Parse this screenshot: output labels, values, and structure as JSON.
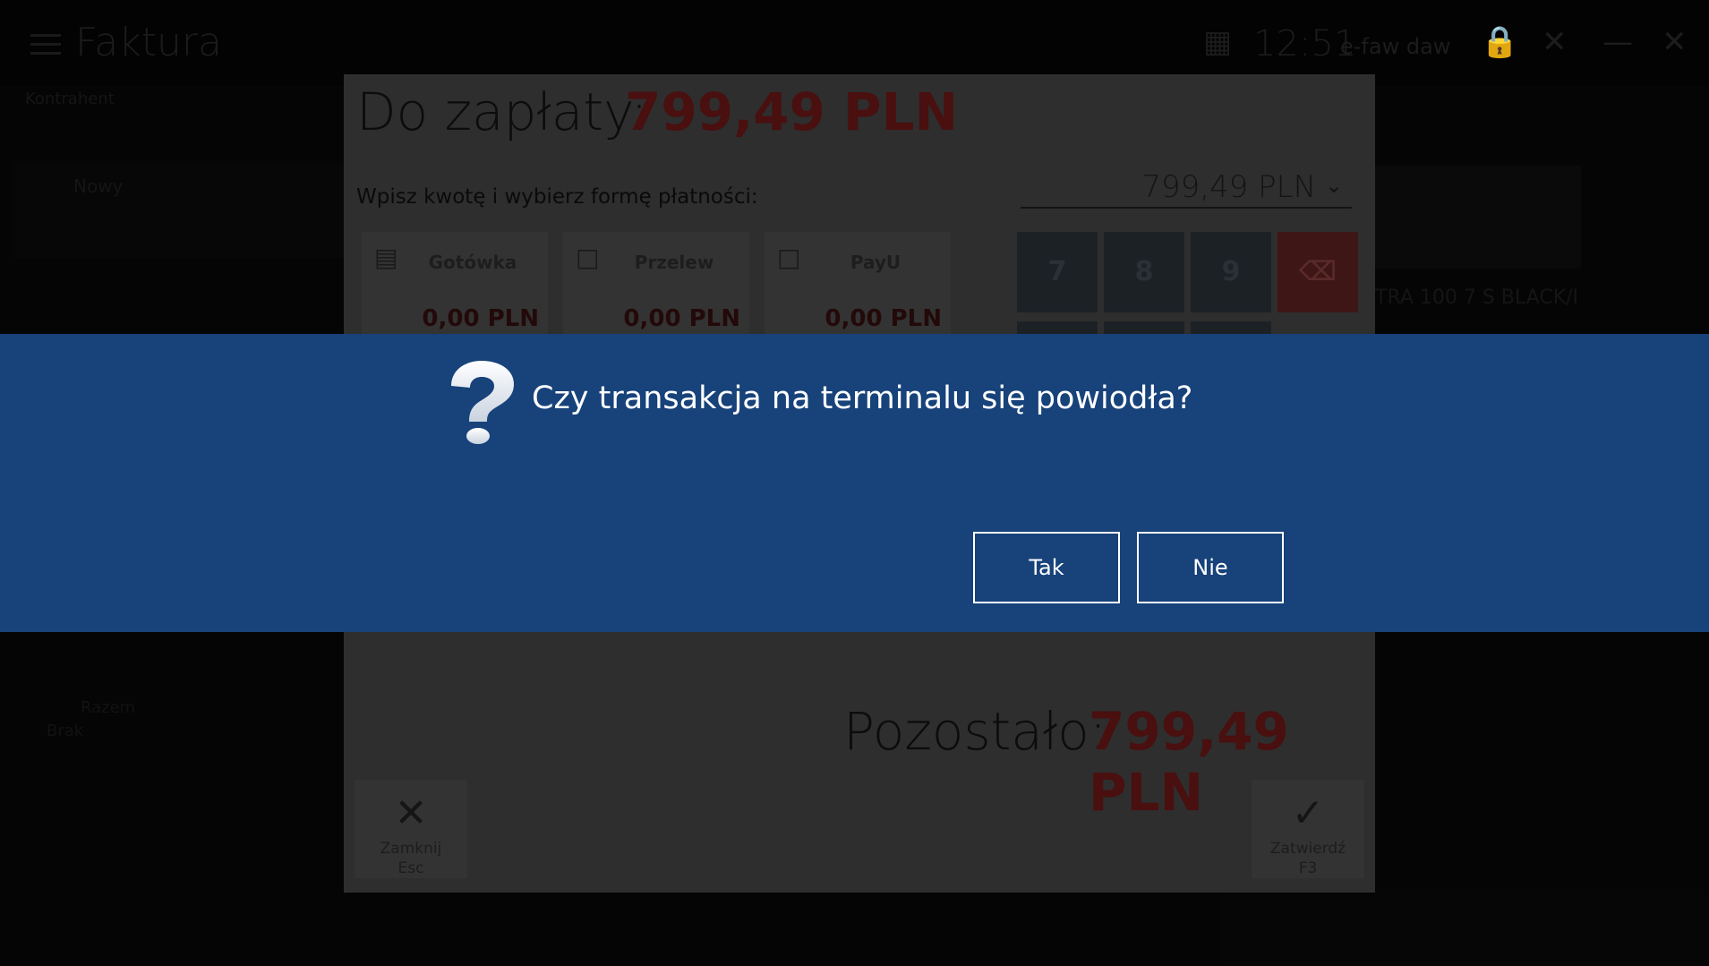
{
  "app": {
    "title": "Faktura",
    "time": "12:51",
    "time_sub": "e-faw daw",
    "section_label": "Kontrahent",
    "left_item": "Nowy",
    "right_product": "TRA 100 7 S BLACK/I",
    "bottom_label_1": "Razem",
    "bottom_label_2": "Brak"
  },
  "payment_dialog": {
    "title": "Do zapłaty:",
    "amount": "799,49 PLN",
    "hint": "Wpisz kwotę i wybierz formę płatności:",
    "selected_amount": "799,49 PLN",
    "methods": [
      {
        "label": "Gotówka",
        "value": "0,00 PLN",
        "icon": "cash-icon"
      },
      {
        "label": "Przelew",
        "value": "0,00 PLN",
        "icon": "document-icon"
      },
      {
        "label": "PayU",
        "value": "0,00 PLN",
        "icon": "document-icon"
      }
    ],
    "keypad": [
      "7",
      "8",
      "9"
    ],
    "remaining_label": "Pozostało:",
    "remaining_amount": "799,49 PLN",
    "close_label": "Zamknij",
    "close_key": "Esc",
    "confirm_label": "Zatwierdź",
    "confirm_key": "F3"
  },
  "confirm_dialog": {
    "icon": "question-icon",
    "message": "Czy transakcja na terminalu się powiodła?",
    "yes_label": "Tak",
    "no_label": "Nie",
    "background": "#17427a"
  },
  "colors": {
    "banner": "#17427a",
    "accent_red": "#c8102e",
    "text_light": "#ffffff"
  }
}
